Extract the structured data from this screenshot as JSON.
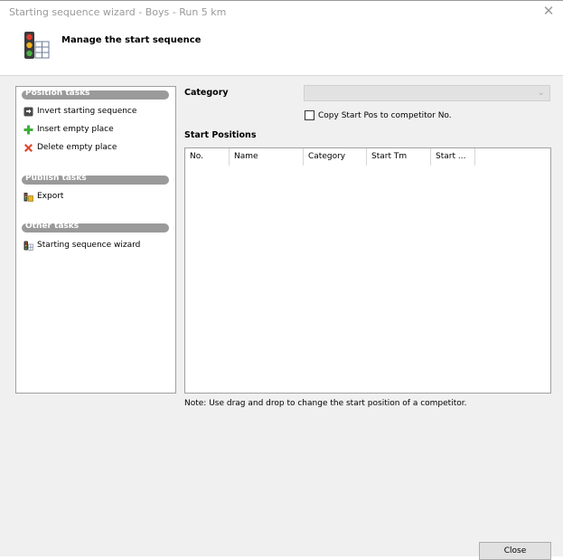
{
  "window": {
    "title": "Starting sequence wizard - Boys - Run 5 km",
    "close_glyph": "✕"
  },
  "header": {
    "title": "Manage the start sequence",
    "icon": "traffic-light-icon"
  },
  "sidebar": {
    "groups": [
      {
        "label": "Position tasks",
        "items": [
          {
            "label": "Invert starting sequence",
            "icon": "invert-sequence-icon"
          },
          {
            "label": "Insert empty place",
            "icon": "green-plus-icon"
          },
          {
            "label": "Delete empty place",
            "icon": "red-x-icon"
          }
        ]
      },
      {
        "label": "Publish tasks",
        "items": [
          {
            "label": "Export",
            "icon": "export-icon"
          }
        ]
      },
      {
        "label": "Other tasks",
        "items": [
          {
            "label": "Starting sequence wizard",
            "icon": "traffic-light-icon"
          }
        ]
      }
    ]
  },
  "form": {
    "category_label": "Category",
    "category_value": "",
    "copy_checkbox_label": "Copy Start Pos to competitor No.",
    "copy_checked": false,
    "start_positions_label": "Start Positions"
  },
  "grid": {
    "columns": [
      "No.",
      "Name",
      "Category",
      "Start Tm",
      "Start ..."
    ],
    "rows": []
  },
  "note": "Note: Use drag and drop to change the start position of a competitor.",
  "footer": {
    "close_label": "Close"
  },
  "colors": {
    "group_header": "#9a9a9a",
    "window_bg": "#f0f0f0"
  }
}
